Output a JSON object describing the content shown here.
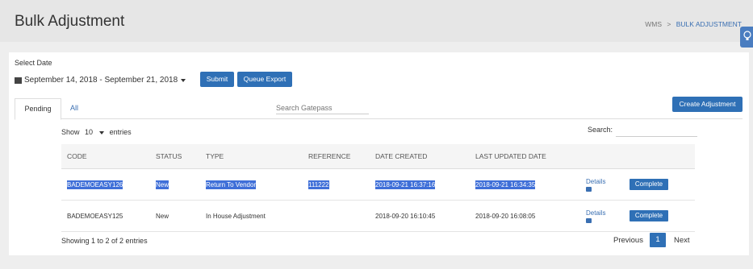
{
  "header": {
    "title": "Bulk Adjustment",
    "breadcrumb": {
      "root": "WMS",
      "separator": ">",
      "current": "BULK ADJUSTMENT"
    }
  },
  "filters": {
    "select_date_label": "Select Date",
    "date_range": "September 14, 2018 - September 21, 2018",
    "submit_label": "Submit",
    "queue_export_label": "Queue Export"
  },
  "tabs": [
    {
      "label": "Pending",
      "active": true
    },
    {
      "label": "All",
      "active": false
    }
  ],
  "gatepass_search": {
    "placeholder": "Search Gatepass"
  },
  "create_label": "Create Adjustment",
  "table_controls": {
    "show_label": "Show",
    "entries_value": "10",
    "entries_label": "entries",
    "search_label": "Search:"
  },
  "table": {
    "columns": [
      "CODE",
      "STATUS",
      "TYPE",
      "REFERENCE",
      "DATE CREATED",
      "LAST UPDATED DATE"
    ],
    "rows": [
      {
        "code": "BADEMOEASY126",
        "status": "New",
        "type": "Return To Vendor",
        "reference": "111222",
        "date_created": "2018-09-21 16:37:16",
        "last_updated": "2018-09-21 16:34:35",
        "details_label": "Details",
        "action_label": "Complete",
        "selected": true
      },
      {
        "code": "BADEMOEASY125",
        "status": "New",
        "type": "In House Adjustment",
        "reference": "",
        "date_created": "2018-09-20 16:10:45",
        "last_updated": "2018-09-20 16:08:05",
        "details_label": "Details",
        "action_label": "Complete",
        "selected": false
      }
    ]
  },
  "footer": {
    "info": "Showing 1 to 2 of 2 entries",
    "previous_label": "Previous",
    "page": "1",
    "next_label": "Next"
  },
  "colors": {
    "primary": "#2f70b6",
    "selection": "#3f6fd8",
    "link": "#3a6fb2"
  }
}
